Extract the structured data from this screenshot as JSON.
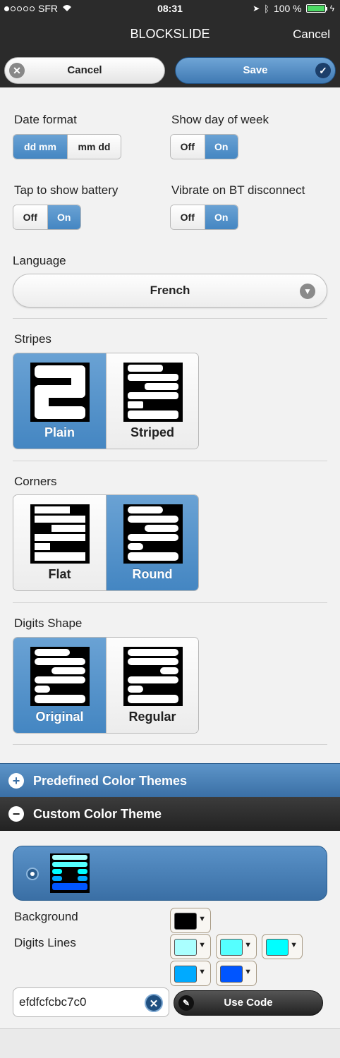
{
  "status_bar": {
    "carrier": "SFR",
    "time": "08:31",
    "battery_percent": "100 %",
    "battery_level": 1.0
  },
  "nav": {
    "title": "BLOCKSLIDE",
    "cancel_label": "Cancel"
  },
  "action_bar": {
    "cancel_label": "Cancel",
    "save_label": "Save"
  },
  "settings": {
    "date_format": {
      "label": "Date format",
      "options": [
        "dd mm",
        "mm dd"
      ],
      "selected": "dd mm"
    },
    "show_day_of_week": {
      "label": "Show day of week",
      "options": [
        "Off",
        "On"
      ],
      "selected": "On"
    },
    "tap_to_show_battery": {
      "label": "Tap to show battery",
      "options": [
        "Off",
        "On"
      ],
      "selected": "On"
    },
    "vibrate_on_bt_disconnect": {
      "label": "Vibrate on BT disconnect",
      "options": [
        "Off",
        "On"
      ],
      "selected": "On"
    },
    "language": {
      "label": "Language",
      "value": "French"
    },
    "stripes": {
      "label": "Stripes",
      "options": [
        "Plain",
        "Striped"
      ],
      "selected": "Plain"
    },
    "corners": {
      "label": "Corners",
      "options": [
        "Flat",
        "Round"
      ],
      "selected": "Round"
    },
    "digits_shape": {
      "label": "Digits Shape",
      "options": [
        "Original",
        "Regular"
      ],
      "selected": "Original"
    }
  },
  "sections": {
    "predefined": {
      "label": "Predefined Color Themes",
      "expanded": false
    },
    "custom": {
      "label": "Custom Color Theme",
      "expanded": true
    }
  },
  "custom_theme": {
    "background_label": "Background",
    "digits_lines_label": "Digits Lines",
    "background_color": "#000000",
    "digit_line_colors": [
      "#aaffff",
      "#55ffff",
      "#00ffff",
      "#00aaff",
      "#0055ff"
    ],
    "code_value": "efdfcfcbc7c0",
    "use_code_label": "Use Code"
  },
  "colors": {
    "accent": "#4486c2",
    "dark_bar": "#2b2b2b"
  }
}
